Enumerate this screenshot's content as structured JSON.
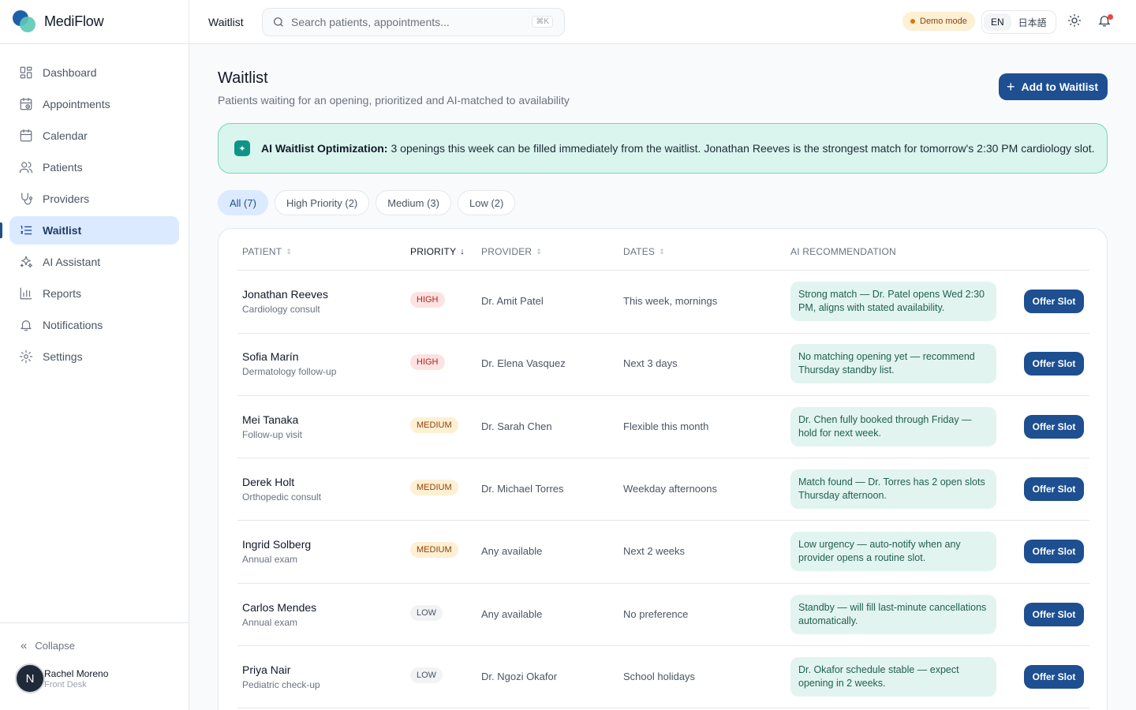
{
  "brand": {
    "name": "MediFlow"
  },
  "sidebar": {
    "items": [
      {
        "label": "Dashboard",
        "icon": "dashboard-icon"
      },
      {
        "label": "Appointments",
        "icon": "calendar-clock-icon"
      },
      {
        "label": "Calendar",
        "icon": "calendar-icon"
      },
      {
        "label": "Patients",
        "icon": "users-icon"
      },
      {
        "label": "Providers",
        "icon": "stethoscope-icon"
      },
      {
        "label": "Waitlist",
        "icon": "list-ordered-icon",
        "active": true
      },
      {
        "label": "AI Assistant",
        "icon": "sparkles-icon"
      },
      {
        "label": "Reports",
        "icon": "bar-chart-icon"
      },
      {
        "label": "Notifications",
        "icon": "bell-icon"
      },
      {
        "label": "Settings",
        "icon": "gear-icon"
      }
    ],
    "collapse_label": "Collapse",
    "user": {
      "initial": "N",
      "name": "Rachel Moreno",
      "role": "Front Desk"
    }
  },
  "topbar": {
    "breadcrumb": "Waitlist",
    "search_placeholder": "Search patients, appointments...",
    "search_shortcut": "⌘K",
    "demo_label": "Demo mode",
    "lang_en": "EN",
    "lang_ja": "日本語"
  },
  "page": {
    "title": "Waitlist",
    "subtitle": "Patients waiting for an opening, prioritized and AI-matched to availability",
    "add_button": "Add to Waitlist"
  },
  "ai_banner": {
    "title": "AI Waitlist Optimization:",
    "text": "3 openings this week can be filled immediately from the waitlist. Jonathan Reeves is the strongest match for tomorrow's 2:30 PM cardiology slot."
  },
  "filters": [
    "All (7)",
    "High Priority (2)",
    "Medium (3)",
    "Low (2)"
  ],
  "table": {
    "headers": {
      "patient": "Patient",
      "priority": "Priority",
      "provider": "Provider",
      "dates": "Dates",
      "ai": "AI Recommendation"
    },
    "offer_label": "Offer Slot",
    "rows": [
      {
        "name": "Jonathan Reeves",
        "reason": "Cardiology consult",
        "priority": "HIGH",
        "level": "high",
        "provider": "Dr. Amit Patel",
        "dates": "This week, mornings",
        "reco": "Strong match — Dr. Patel opens Wed 2:30 PM, aligns with stated availability."
      },
      {
        "name": "Sofia Marín",
        "reason": "Dermatology follow-up",
        "priority": "HIGH",
        "level": "high",
        "provider": "Dr. Elena Vasquez",
        "dates": "Next 3 days",
        "reco": "No matching opening yet — recommend Thursday standby list."
      },
      {
        "name": "Mei Tanaka",
        "reason": "Follow-up visit",
        "priority": "MEDIUM",
        "level": "medium",
        "provider": "Dr. Sarah Chen",
        "dates": "Flexible this month",
        "reco": "Dr. Chen fully booked through Friday — hold for next week."
      },
      {
        "name": "Derek Holt",
        "reason": "Orthopedic consult",
        "priority": "MEDIUM",
        "level": "medium",
        "provider": "Dr. Michael Torres",
        "dates": "Weekday afternoons",
        "reco": "Match found — Dr. Torres has 2 open slots Thursday afternoon."
      },
      {
        "name": "Ingrid Solberg",
        "reason": "Annual exam",
        "priority": "MEDIUM",
        "level": "medium",
        "provider": "Any available",
        "dates": "Next 2 weeks",
        "reco": "Low urgency — auto-notify when any provider opens a routine slot."
      },
      {
        "name": "Carlos Mendes",
        "reason": "Annual exam",
        "priority": "LOW",
        "level": "low",
        "provider": "Any available",
        "dates": "No preference",
        "reco": "Standby — will fill last-minute cancellations automatically."
      },
      {
        "name": "Priya Nair",
        "reason": "Pediatric check-up",
        "priority": "LOW",
        "level": "low",
        "provider": "Dr. Ngozi Okafor",
        "dates": "School holidays",
        "reco": "Dr. Okafor schedule stable — expect opening in 2 weeks."
      }
    ]
  }
}
